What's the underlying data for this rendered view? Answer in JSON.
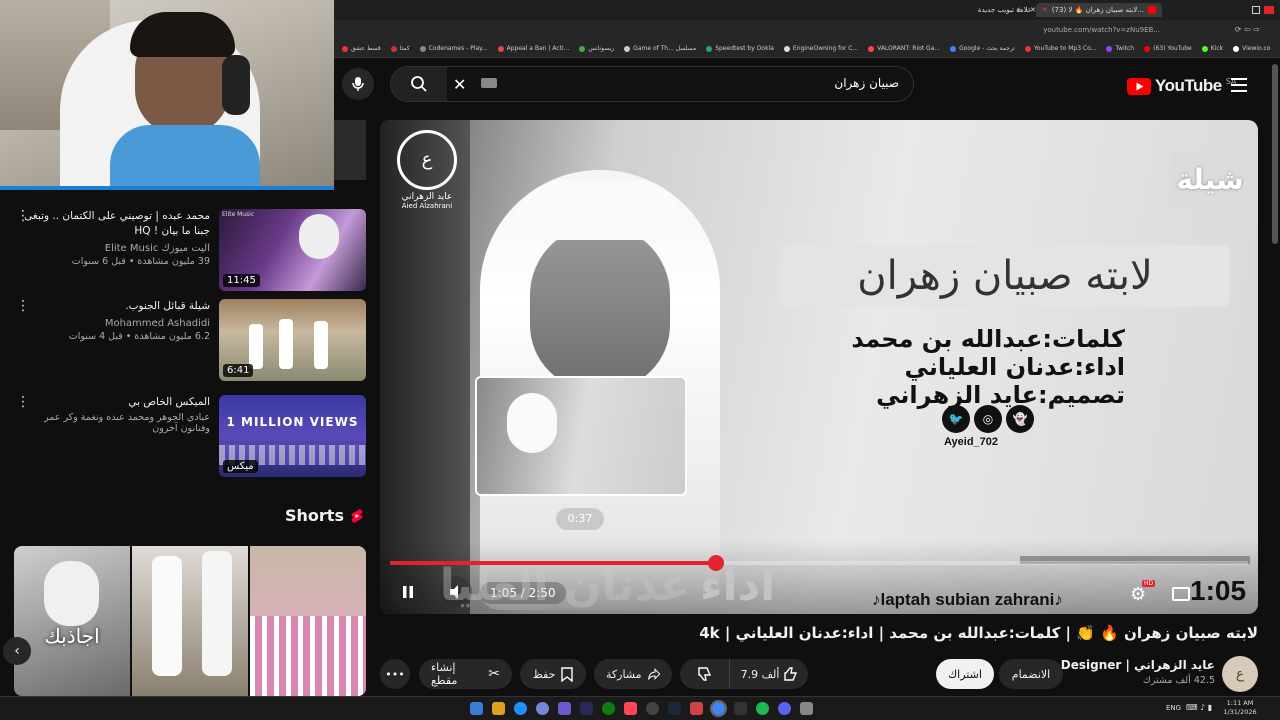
{
  "browser": {
    "tab_active": "(73) لابته صبيان زهران 🔥 لا...",
    "tab_other": "علامة تبويب جديدة",
    "url": "youtube.com/watch?v=zNu9EB...",
    "bookmarks": [
      "قسط عشق",
      "كمثا",
      "Codenames - Play...",
      "Appeal a Ban | Acti...",
      "ريسونانس",
      "Game of Th... مسلسل",
      "Speedtest by Ookla",
      "EngineOwning for C...",
      "VALORANT: Riot Ga...",
      "Google - ترجمة بحث",
      "YouTube to Mp3 Co...",
      "Twitch",
      "(63) YouTube",
      "Kick",
      "Viewio.co"
    ]
  },
  "header": {
    "logo_text": "YouTube",
    "region": "SA",
    "search_value": "صبيان زهران"
  },
  "sidebar": {
    "recommendations": [
      {
        "title": "محمد عبده | توصيني على الكتمان .. وتبغى جبنا ما بيان ! HQ",
        "channel": "اليت ميوزك Elite Music",
        "meta": "39 مليون مشاهدة • قبل 6 سنوات",
        "duration": "11:45",
        "thumb_label": "Elite Music"
      },
      {
        "title": "شيلة قبائل الجنوب.",
        "channel": "Mohammed Ashadidi",
        "meta": "6.2 مليون مشاهدة • قبل 4 سنوات",
        "duration": "6:41",
        "thumb_label": ""
      },
      {
        "title": "الميكس الخاص بي",
        "channel": "عبادي الجوهر ومحمد عبده ونغمة وكر عمر وفنانون آخرون",
        "meta": "",
        "duration": "ميكس",
        "thumb_label": "1 MILLION VIEWS"
      }
    ],
    "shorts_title": "Shorts",
    "shorts_overlay": "اجاذبك"
  },
  "player": {
    "brand": "Aied Alzahrani",
    "brand_ar": "عايد الزهراني",
    "genre_tag": "شيلة",
    "song_title_art": "لابته صبيان زهران",
    "credits": [
      "كلمات:عبدالله بن محمد",
      "اداء:عدنان العلياني",
      "تصميم:عايد الزهراني"
    ],
    "social_handle": "Ayeid_702",
    "preview_time": "0:37",
    "current_time": "1:05",
    "total_time": "2:50",
    "progress": 0.38,
    "overlay_text": "laptah subian zahrani",
    "big_time": "1:05",
    "hd_badge": "HD",
    "bg_word_1": "اداء",
    "bg_word_2": "عدنان العلياني"
  },
  "video": {
    "title": "لابته صبيان زهران 🔥 👏 | كلمات:عبدالله بن محمد | اداء:عدنان العلياني | 4k",
    "channel": "عايد الزهراني | Designer",
    "subscribers": "42.5 ألف مشترك",
    "join_label": "الانضمام",
    "subscribe_label": "اشتراك",
    "likes": "7.9 ألف",
    "share_label": "مشاركة",
    "save_label": "حفظ",
    "clip_label": "إنشاء مقطع"
  },
  "taskbar": {
    "lang": "ENG",
    "time": "1:11 AM",
    "date": "1/31/2026"
  },
  "colors": {
    "yt_red": "#ff0000",
    "progress_red": "#e5232f",
    "bg": "#0f0f0f"
  }
}
